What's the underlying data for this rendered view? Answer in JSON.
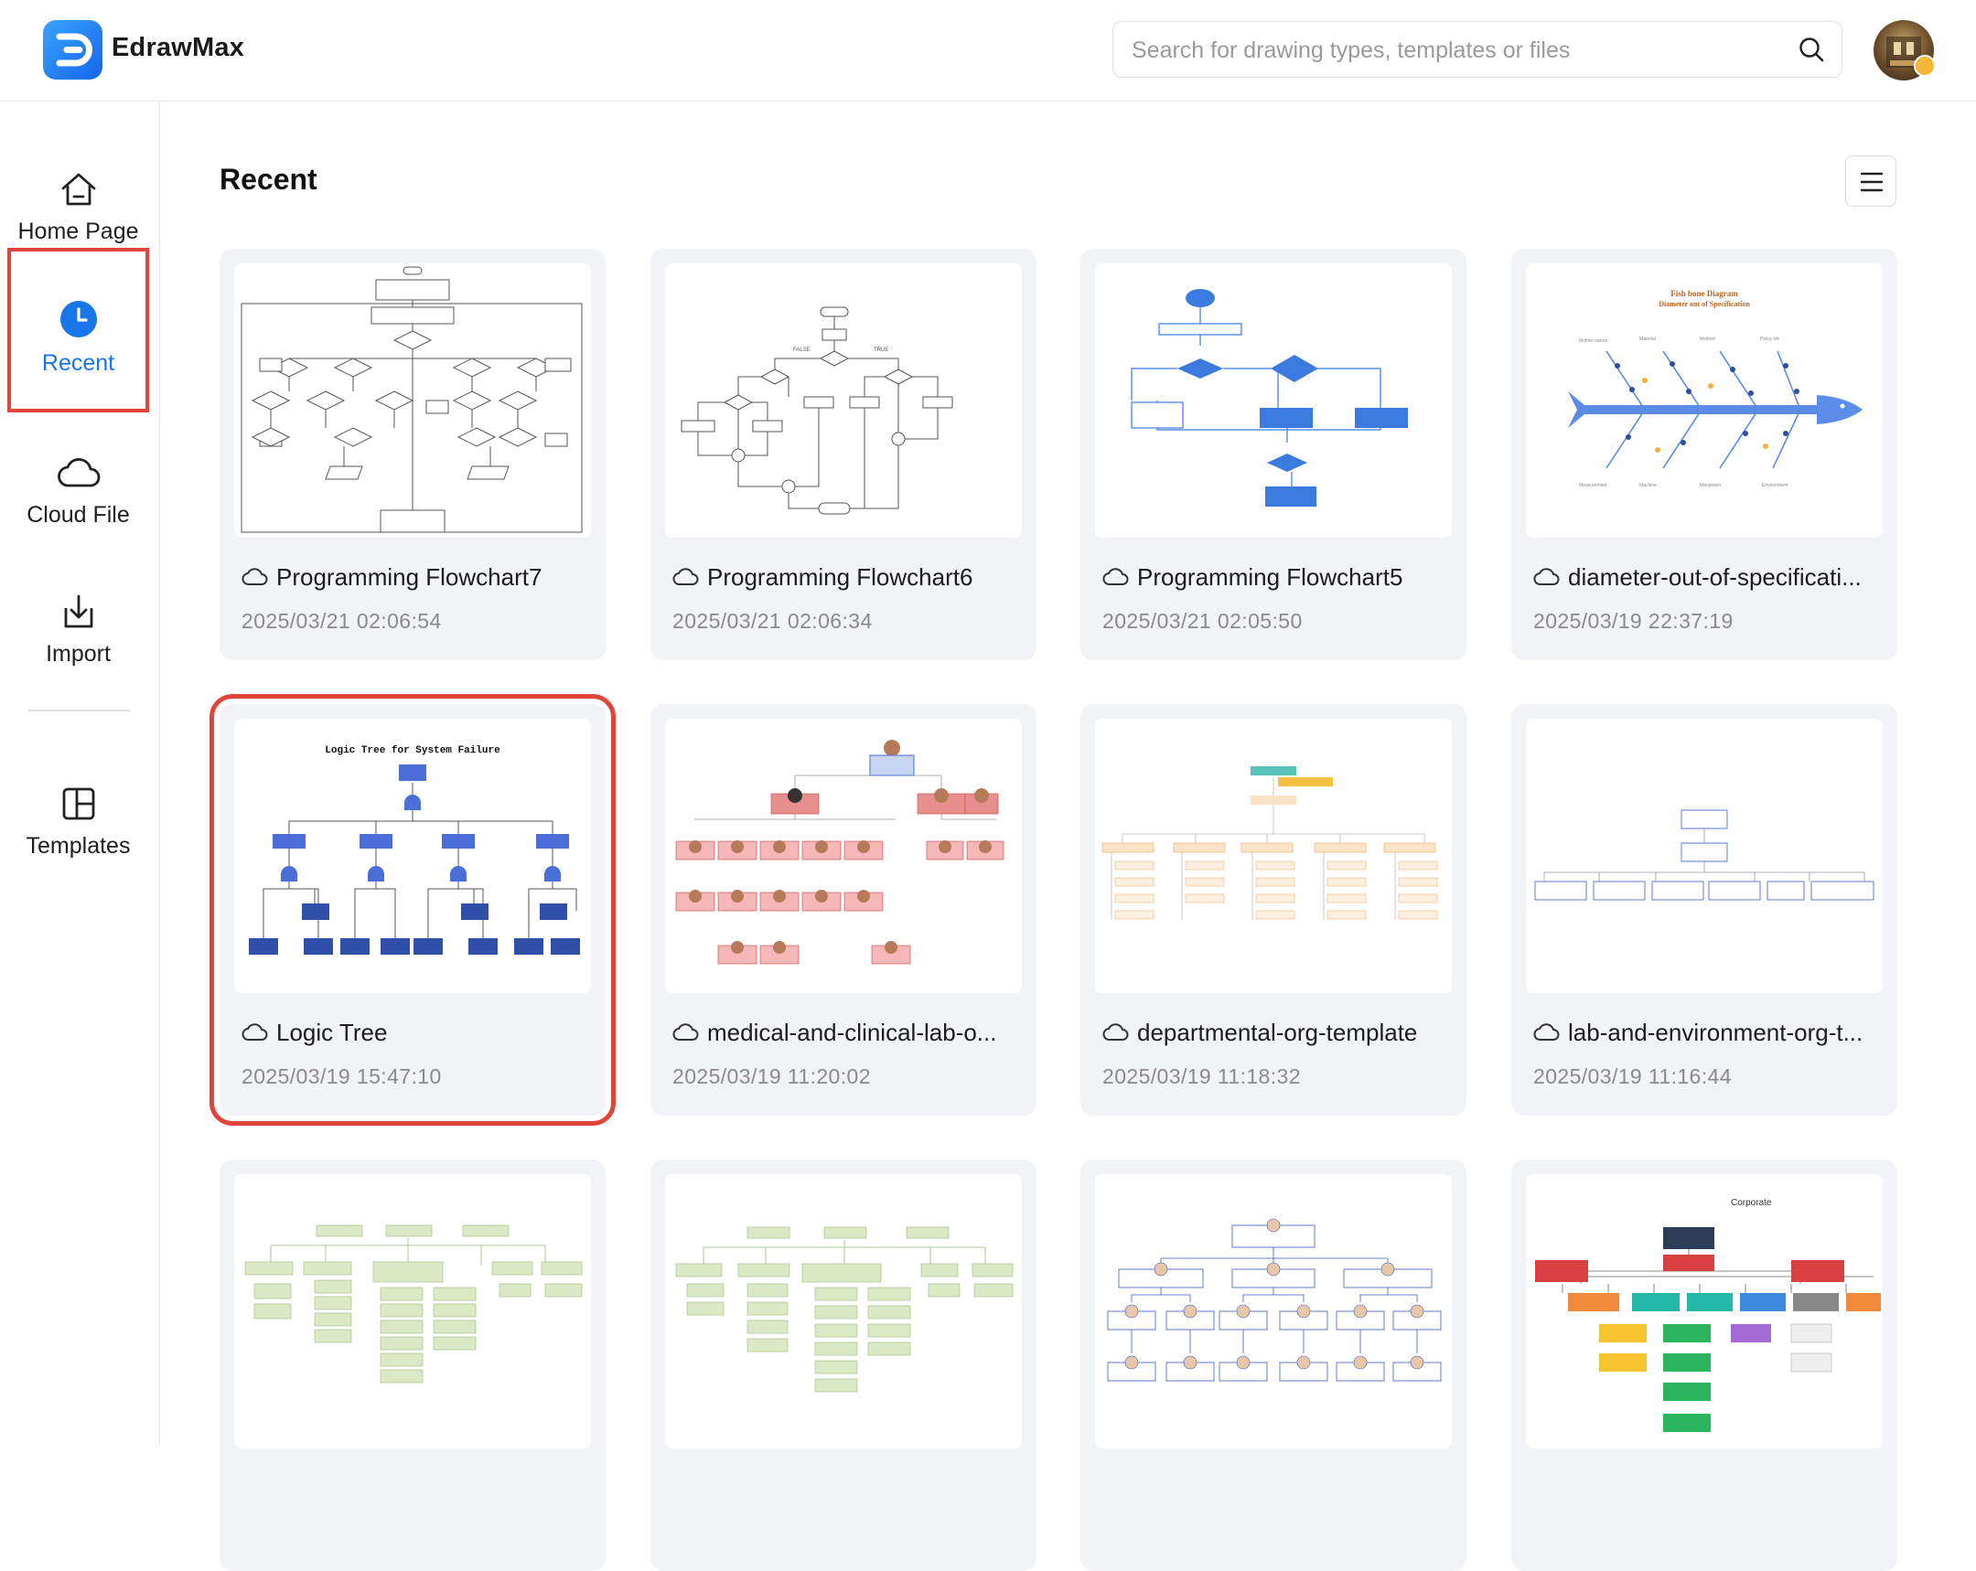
{
  "app": {
    "name": "EdrawMax",
    "logo_icon": "edrawmax-logo-icon"
  },
  "search": {
    "placeholder": "Search for drawing types, templates or files",
    "value": ""
  },
  "user": {
    "avatar": "avatar",
    "badge_color": "#f4b738"
  },
  "sidebar": {
    "items": [
      {
        "id": "home",
        "label": "Home Page",
        "icon": "home-icon",
        "active": false
      },
      {
        "id": "recent",
        "label": "Recent",
        "icon": "clock-icon",
        "active": true
      },
      {
        "id": "cloud",
        "label": "Cloud File",
        "icon": "cloud-icon",
        "active": false
      },
      {
        "id": "import",
        "label": "Import",
        "icon": "import-icon",
        "active": false
      },
      {
        "id": "templates",
        "label": "Templates",
        "icon": "templates-icon",
        "active": false
      }
    ]
  },
  "main": {
    "title": "Recent",
    "view_toggle_icon": "list-view-icon",
    "files": [
      {
        "name": "Programming Flowchart7",
        "date": "2025/03/21 02:06:54",
        "thumb": "flowchart-gray"
      },
      {
        "name": "Programming Flowchart6",
        "date": "2025/03/21 02:06:34",
        "thumb": "flowchart-gray-2"
      },
      {
        "name": "Programming Flowchart5",
        "date": "2025/03/21 02:05:50",
        "thumb": "flowchart-blue"
      },
      {
        "name": "diameter-out-of-specificati...",
        "date": "2025/03/19 22:37:19",
        "thumb": "fishbone",
        "thumb_title": "Fish bone Diagram",
        "thumb_subtitle": "Diameter out of Specification"
      },
      {
        "name": "Logic Tree",
        "date": "2025/03/19 15:47:10",
        "thumb": "logic-tree",
        "thumb_title": "Logic Tree for System Failure",
        "highlighted": true
      },
      {
        "name": "medical-and-clinical-lab-o...",
        "date": "2025/03/19 11:20:02",
        "thumb": "org-red"
      },
      {
        "name": "departmental-org-template",
        "date": "2025/03/19 11:18:32",
        "thumb": "org-orange"
      },
      {
        "name": "lab-and-environment-org-t...",
        "date": "2025/03/19 11:16:44",
        "thumb": "org-blue-outline"
      },
      {
        "name": "",
        "date": "",
        "thumb": "org-green"
      },
      {
        "name": "",
        "date": "",
        "thumb": "org-green-2"
      },
      {
        "name": "",
        "date": "",
        "thumb": "org-avatars"
      },
      {
        "name": "",
        "date": "",
        "thumb": "org-colorful",
        "thumb_title": "Corporate"
      }
    ]
  },
  "colors": {
    "accent": "#1976e8",
    "highlight": "#e0453a",
    "card_bg": "#f2f3f6"
  }
}
